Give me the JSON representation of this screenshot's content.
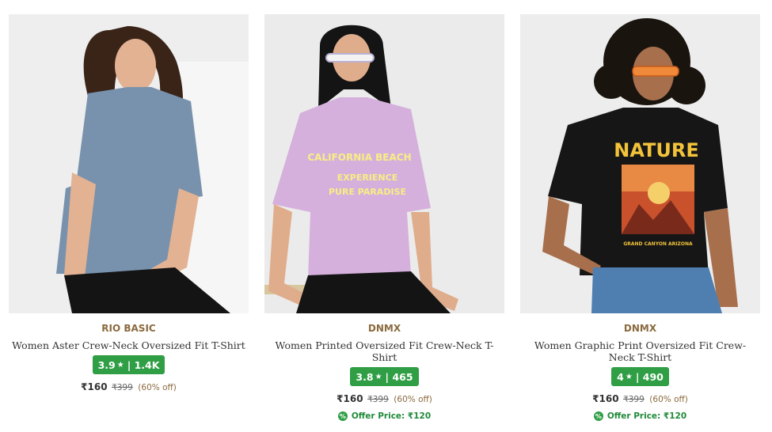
{
  "products": [
    {
      "brand": "RIO BASIC",
      "name": "Women Aster Crew-Neck Oversized Fit T-Shirt",
      "rating": "3.9",
      "rating_count": "| 1.4K",
      "price": "₹160",
      "mrp": "₹399",
      "discount": "(60% off)",
      "offer": "",
      "shirt_color": "#7892ad"
    },
    {
      "brand": "DNMX",
      "name": "Women Printed Oversized Fit Crew-Neck T-Shirt",
      "rating": "3.8",
      "rating_count": "| 465",
      "price": "₹160",
      "mrp": "₹399",
      "discount": "(60% off)",
      "offer": "Offer Price: ₹120",
      "shirt_color": "#d5b0dc"
    },
    {
      "brand": "DNMX",
      "name": "Women Graphic Print Oversized Fit Crew-Neck T-Shirt",
      "rating": "4",
      "rating_count": "| 490",
      "price": "₹160",
      "mrp": "₹399",
      "discount": "(60% off)",
      "offer": "Offer Price: ₹120",
      "shirt_color": "#161616"
    }
  ],
  "star_glyph": "★",
  "offer_icon": "%",
  "colors": {
    "brand": "#8b6a3e",
    "rating_bg": "#2f9e44",
    "offer": "#1f8a3a"
  }
}
